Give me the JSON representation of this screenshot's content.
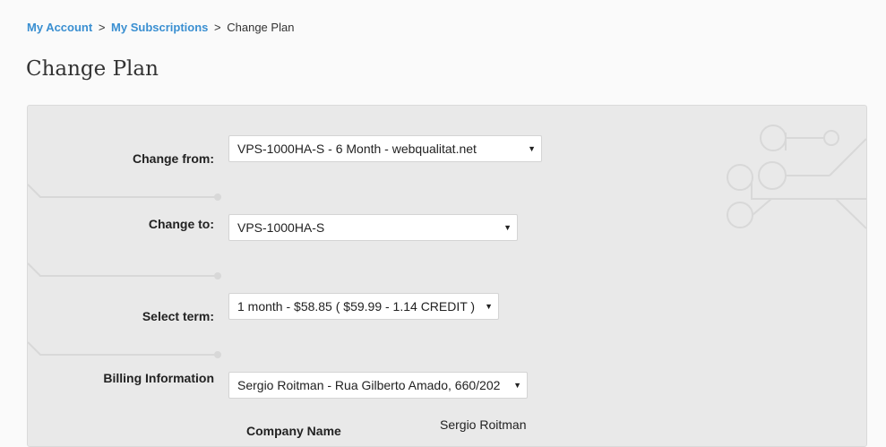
{
  "breadcrumb": {
    "items": [
      "My Account",
      "My Subscriptions"
    ],
    "current": "Change Plan",
    "separator": ">"
  },
  "page": {
    "title": "Change Plan"
  },
  "form": {
    "change_from": {
      "label": "Change from:",
      "value": "VPS-1000HA-S - 6 Month - webqualitat.net"
    },
    "change_to": {
      "label": "Change to:",
      "value": "VPS-1000HA-S"
    },
    "select_term": {
      "label": "Select term:",
      "value": "1 month - $58.85 ( $59.99 - 1.14 CREDIT )"
    },
    "billing": {
      "label": "Billing Information",
      "value": "Sergio Roitman - Rua Gilberto Amado, 660/202"
    },
    "summary": {
      "label_partial": "Company Name",
      "value_partial": "Sergio Roitman"
    }
  },
  "colors": {
    "link": "#3a8fd1",
    "panel_bg": "#e9e9e9",
    "decor": "#d8d8d8"
  },
  "icons": {
    "dropdown": "triangle-down-icon"
  }
}
